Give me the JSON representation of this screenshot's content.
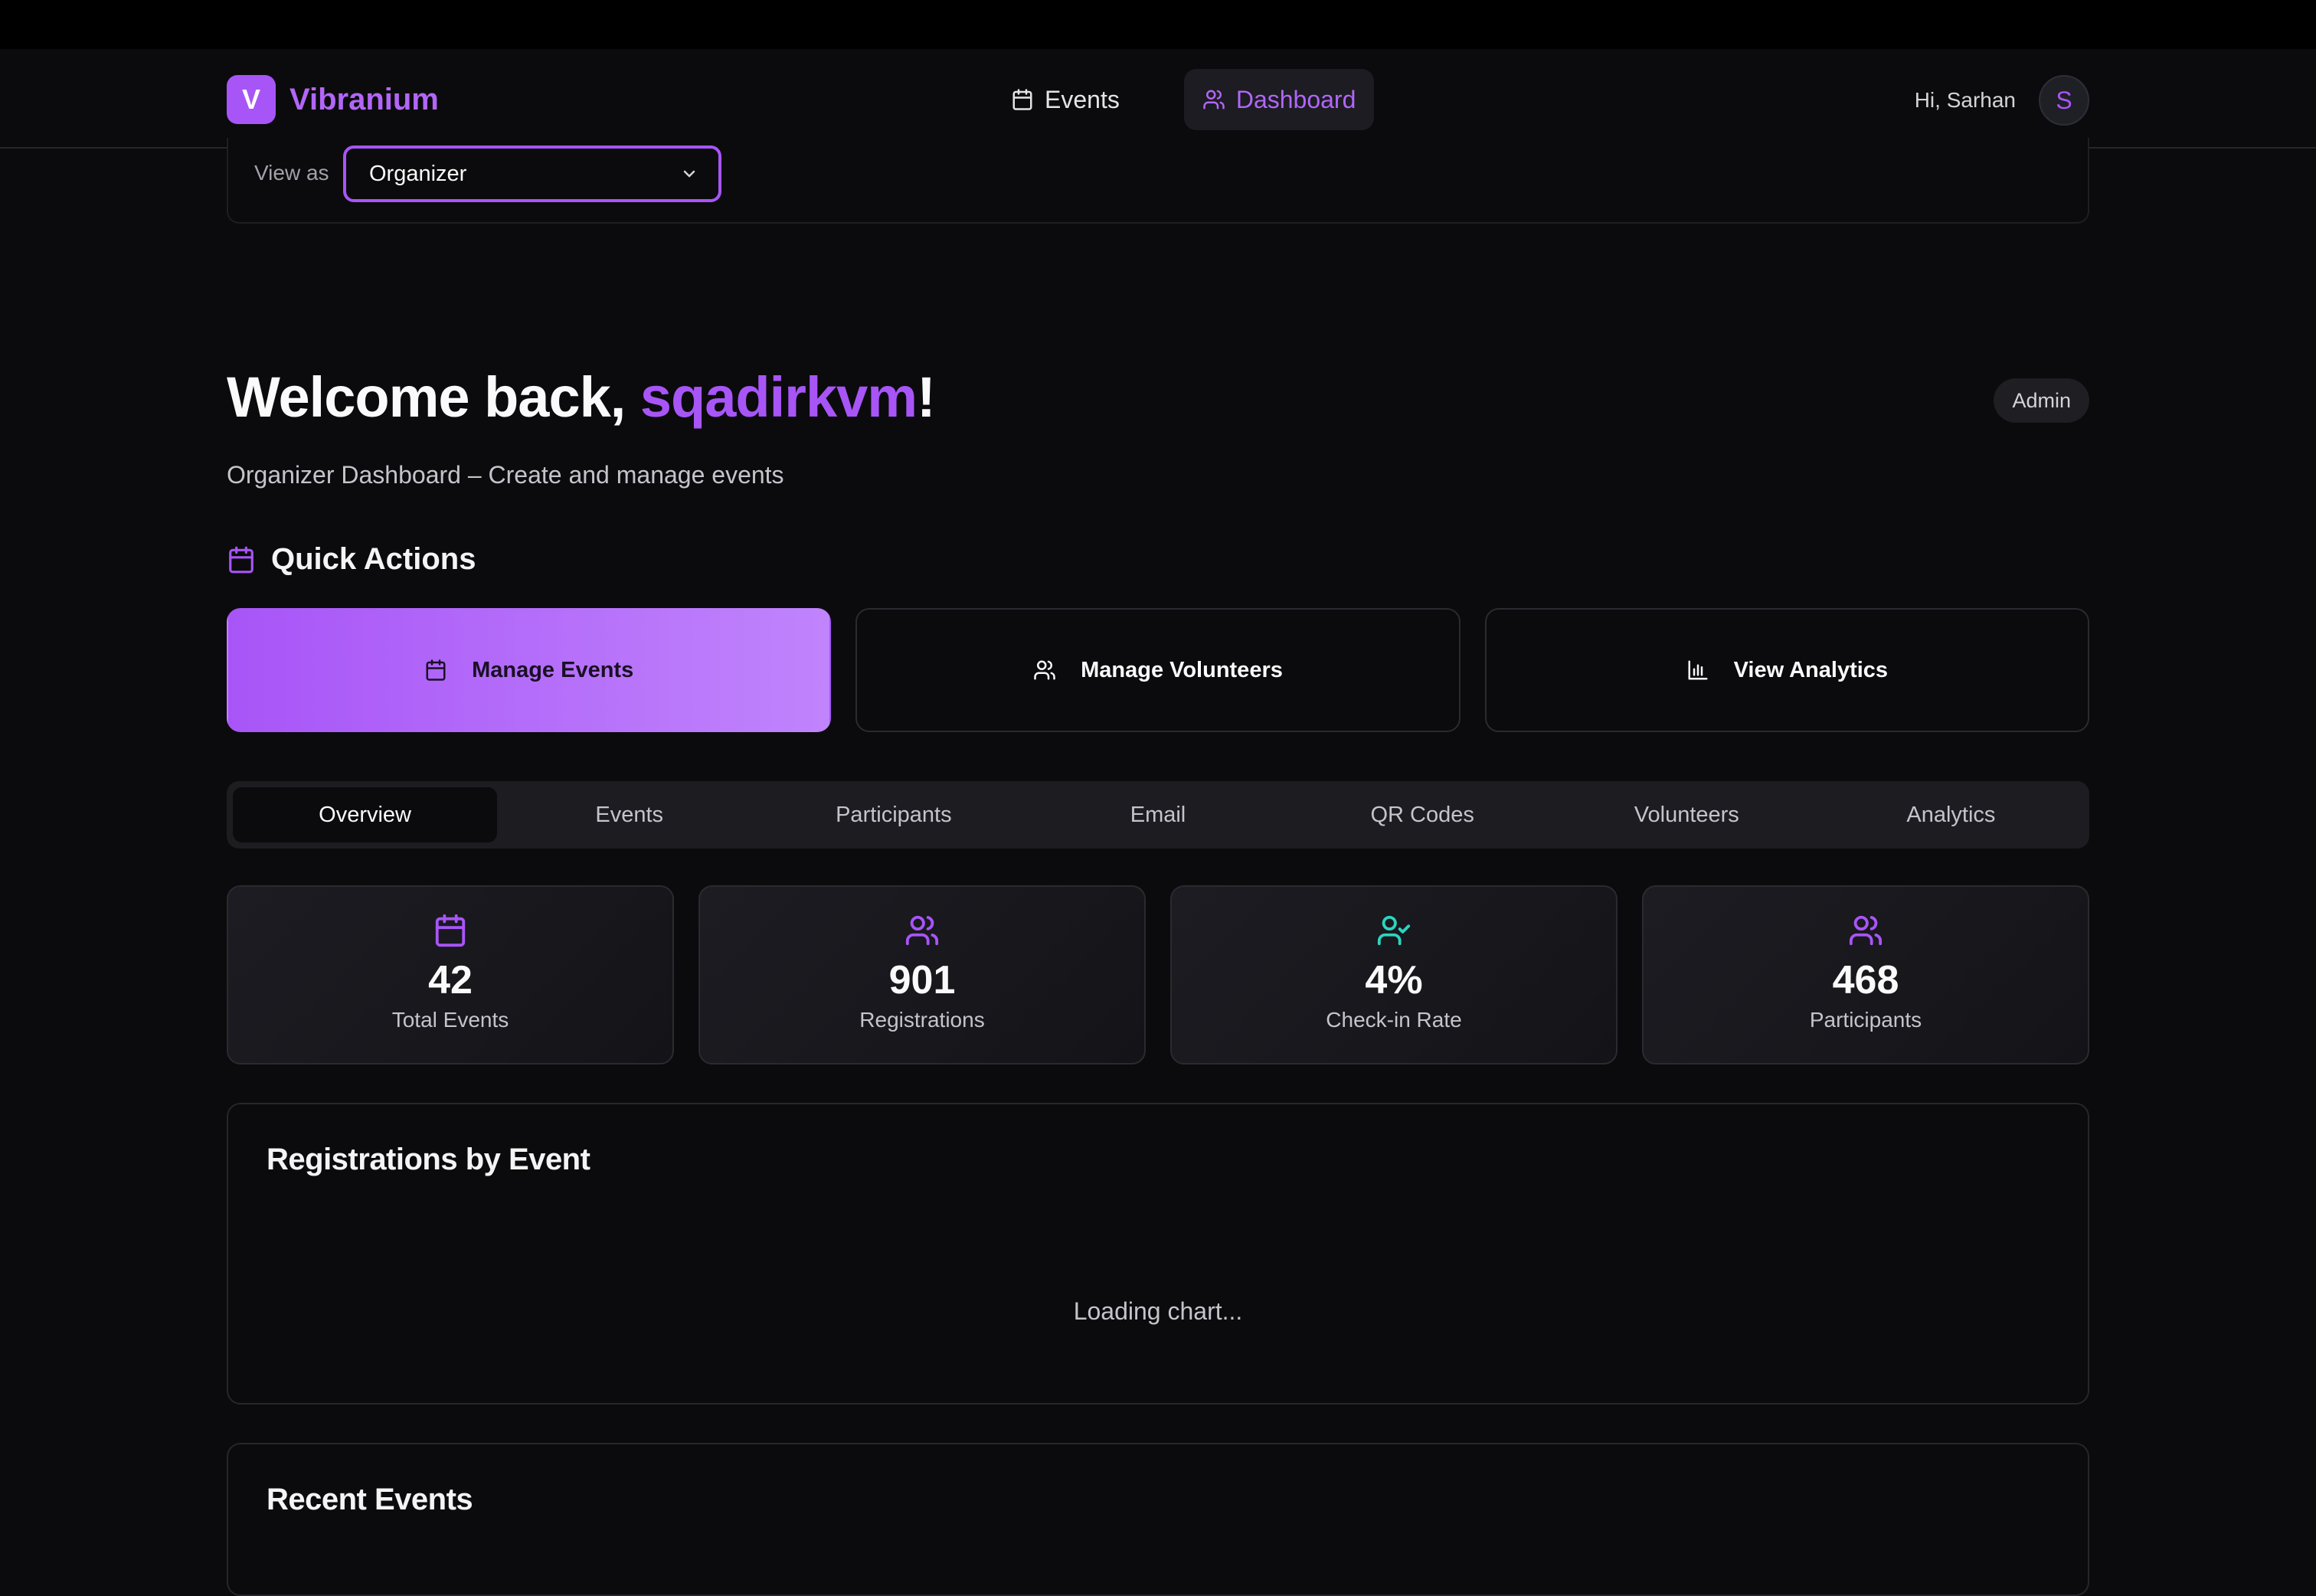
{
  "brand": {
    "mark": "V",
    "name": "Vibranium"
  },
  "nav": {
    "events": "Events",
    "dashboard": "Dashboard"
  },
  "user": {
    "greeting": "Hi, Sarhan",
    "initial": "S"
  },
  "view_as": {
    "label": "View as",
    "selected": "Organizer"
  },
  "welcome": {
    "prefix": "Welcome back, ",
    "name": "sqadirkvm",
    "suffix": "!"
  },
  "role_badge": "Admin",
  "subtitle": "Organizer Dashboard – Create and manage events",
  "quick_actions": {
    "title": "Quick Actions",
    "manage_events": "Manage Events",
    "manage_volunteers": "Manage Volunteers",
    "view_analytics": "View Analytics"
  },
  "tabs": [
    "Overview",
    "Events",
    "Participants",
    "Email",
    "QR Codes",
    "Volunteers",
    "Analytics"
  ],
  "stats": [
    {
      "value": "42",
      "label": "Total Events"
    },
    {
      "value": "901",
      "label": "Registrations"
    },
    {
      "value": "4%",
      "label": "Check-in Rate"
    },
    {
      "value": "468",
      "label": "Participants"
    }
  ],
  "chart_card": {
    "title": "Registrations by Event",
    "loading": "Loading chart..."
  },
  "recent_events": {
    "title": "Recent Events"
  },
  "colors": {
    "accent": "#a855f7",
    "checkin_icon": "#2dd4bf",
    "background": "#0b0b0d"
  }
}
